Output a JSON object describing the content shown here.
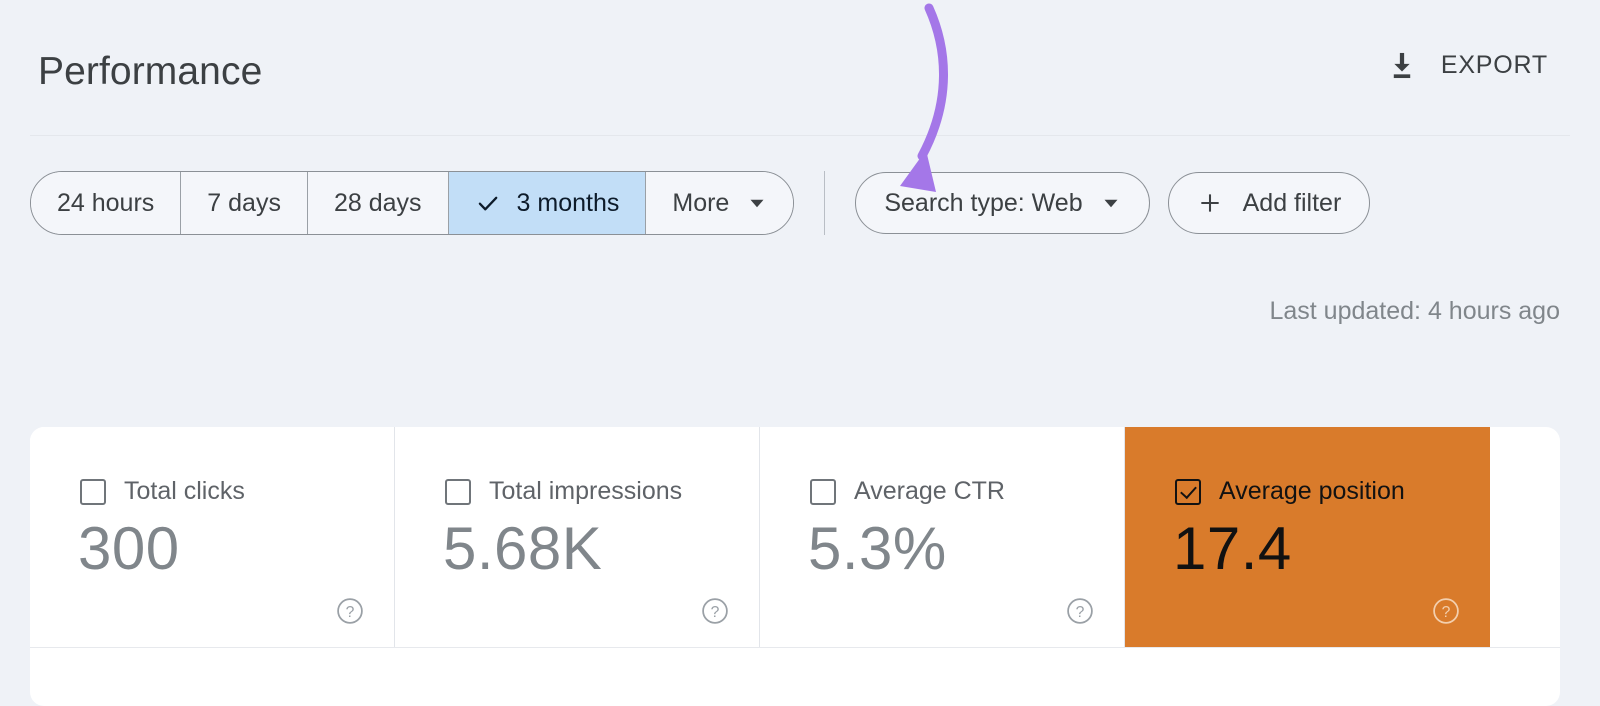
{
  "header": {
    "title": "Performance",
    "export_label": "EXPORT",
    "export_icon": "download-icon"
  },
  "toolbar": {
    "date_range_segments": [
      {
        "label": "24 hours",
        "selected": false
      },
      {
        "label": "7 days",
        "selected": false
      },
      {
        "label": "28 days",
        "selected": false
      },
      {
        "label": "3 months",
        "selected": true
      },
      {
        "label": "More",
        "selected": false,
        "has_caret": true
      }
    ],
    "search_type_label": "Search type: Web",
    "add_filter_label": "Add filter",
    "plus_icon": "plus-icon",
    "caret_icon": "chevron-down-icon",
    "check_icon": "check-icon"
  },
  "status": {
    "last_updated": "Last updated: 4 hours ago"
  },
  "metrics": [
    {
      "label": "Total clicks",
      "value": "300",
      "selected": false
    },
    {
      "label": "Total impressions",
      "value": "5.68K",
      "selected": false
    },
    {
      "label": "Average CTR",
      "value": "5.3%",
      "selected": false
    },
    {
      "label": "Average position",
      "value": "17.4",
      "selected": true
    }
  ],
  "help_icon": "help-circle-icon",
  "colors": {
    "background": "#eff2f7",
    "card": "#ffffff",
    "selected_segment": "#c2def7",
    "active_metric": "#d97b2b",
    "text_primary": "#3c4043",
    "text_muted": "#80868b",
    "annotation": "#a477e8"
  },
  "annotation": {
    "type": "curved-arrow",
    "points_to": "More"
  }
}
